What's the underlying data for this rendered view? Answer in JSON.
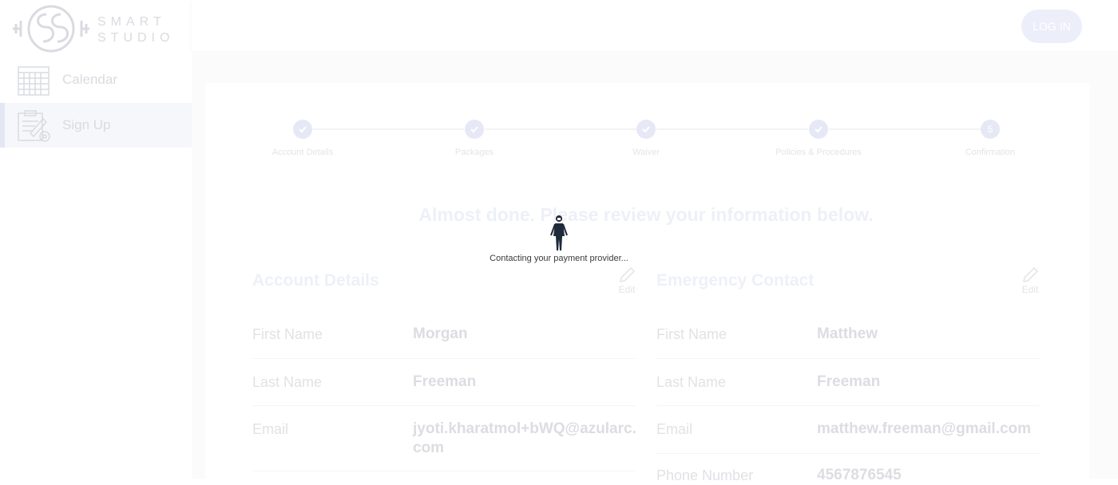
{
  "app": {
    "logo_text": "SMART STUDIO",
    "colors": {
      "accent": "#e6e9f5",
      "text_faded": "#dcdde2",
      "overlay_text": "#3a3a3a"
    }
  },
  "sidebar": {
    "items": [
      {
        "label": "Calendar",
        "icon": "calendar-icon"
      },
      {
        "label": "Sign Up",
        "icon": "signup-clipboard-icon",
        "active": true
      }
    ]
  },
  "header": {
    "login_label": "LOG IN"
  },
  "stepper": {
    "steps": [
      {
        "label": "Account Details",
        "state": "complete"
      },
      {
        "label": "Packages",
        "state": "complete"
      },
      {
        "label": "Waiver",
        "state": "complete"
      },
      {
        "label": "Policies & Procedures",
        "state": "complete"
      },
      {
        "label": "Confirmation",
        "state": "current",
        "number": "5"
      }
    ]
  },
  "review": {
    "heading": "Almost done. Please review your information below.",
    "edit_label": "Edit",
    "account": {
      "title": "Account Details",
      "fields": [
        {
          "label": "First Name",
          "value": "Morgan"
        },
        {
          "label": "Last Name",
          "value": "Freeman"
        },
        {
          "label": "Email",
          "value": "jyoti.kharatmol+bWQ@azularc.com"
        }
      ]
    },
    "emergency": {
      "title": "Emergency Contact",
      "fields": [
        {
          "label": "First Name",
          "value": "Matthew"
        },
        {
          "label": "Last Name",
          "value": "Freeman"
        },
        {
          "label": "Email",
          "value": "matthew.freeman@gmail.com"
        },
        {
          "label": "Phone Number",
          "value": "4567876545"
        }
      ]
    }
  },
  "overlay": {
    "message": "Contacting your payment provider...",
    "icon": "person-loading-icon"
  }
}
